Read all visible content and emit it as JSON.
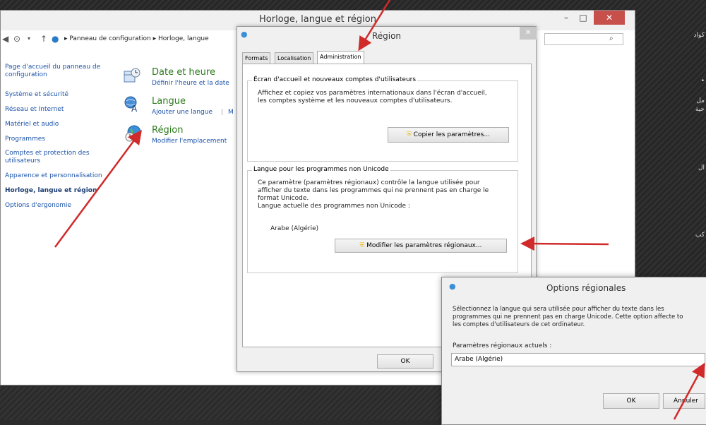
{
  "background": {
    "arabic_snippets": [
      "كواد",
      "•",
      "مل",
      "جية",
      "ال",
      "كب"
    ]
  },
  "control_panel": {
    "title": "Horloge, langue et région",
    "window_buttons": {
      "minimize": "–",
      "maximize": "□",
      "close": "✕"
    },
    "breadcrumb": [
      "Panneau de configuration",
      "Horloge, langue"
    ],
    "sidebar": {
      "items": [
        "Page d'accueil du panneau de configuration",
        "Système et sécurité",
        "Réseau et Internet",
        "Matériel et audio",
        "Programmes",
        "Comptes et protection des utilisateurs",
        "Apparence et personnalisation",
        "Horloge, langue et région",
        "Options d'ergonomie"
      ],
      "active_index": 7
    },
    "categories": [
      {
        "title": "Date et heure",
        "link": "Définir l'heure et la date"
      },
      {
        "title": "Langue",
        "link": "Ajouter une langue",
        "link2": "M"
      },
      {
        "title": "Région",
        "link": "Modifier l'emplacement"
      }
    ]
  },
  "region_dialog": {
    "title": "Région",
    "tabs": [
      "Formats",
      "Localisation",
      "Administration"
    ],
    "active_tab": 2,
    "welcome_group": {
      "title": "Écran d'accueil et nouveaux comptes d'utilisateurs",
      "text": [
        "Affichez et copiez vos paramètres internationaux dans l'écran d'accueil,",
        "les comptes système et les nouveaux comptes d'utilisateurs."
      ],
      "button": "Copier les paramètres..."
    },
    "unicode_group": {
      "title": "Langue pour les programmes non Unicode",
      "text": [
        "Ce paramètre (paramètres régionaux) contrôle la langue utilisée pour",
        "afficher du texte dans les programmes qui ne prennent pas en charge le",
        "format Unicode."
      ],
      "current_label": "Langue actuelle des programmes non Unicode :",
      "current_value": "Arabe (Algérie)",
      "button": "Modifier les paramètres régionaux..."
    },
    "ok_button": "OK"
  },
  "regional_options": {
    "title": "Options régionales",
    "text": [
      "Sélectionnez la langue qui sera utilisée pour afficher du texte dans les",
      "programmes qui ne prennent pas en charge Unicode. Cette option affecte to",
      "les comptes d'utilisateurs de cet ordinateur."
    ],
    "current_label": "Paramètres régionaux actuels :",
    "current_value": "Arabe (Algérie)",
    "ok_button": "OK",
    "cancel_button": "Annuler"
  },
  "colors": {
    "arrow": "#d12a2a",
    "category_title": "#2c7a1c",
    "link": "#1a52a8",
    "close": "#c7504b"
  }
}
